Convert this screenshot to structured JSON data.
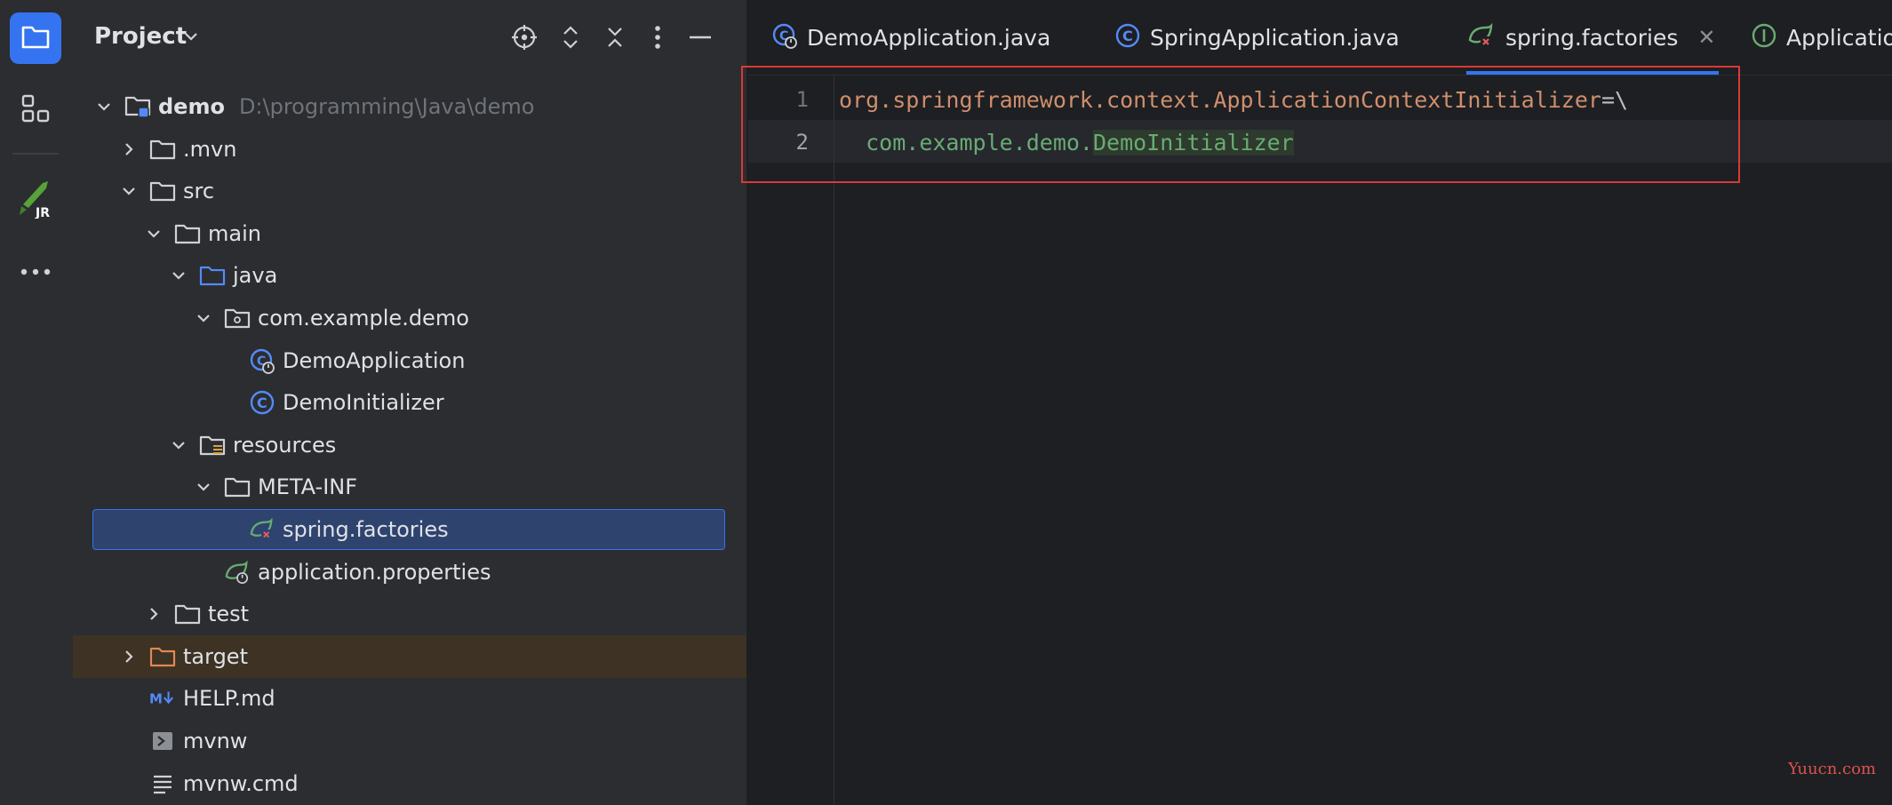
{
  "activity_bar": {
    "items": [
      {
        "name": "project-icon",
        "active": true
      },
      {
        "name": "structure-icon",
        "active": false
      },
      {
        "name": "jrebel-icon",
        "active": false,
        "label": "JR"
      },
      {
        "name": "more-icon",
        "active": false
      }
    ]
  },
  "project_panel": {
    "title": "Project",
    "header_icons": [
      "locate-icon",
      "expand-collapse-icon",
      "close-all-icon",
      "options-icon",
      "hide-icon"
    ],
    "tree": [
      {
        "label": "demo",
        "path": "D:\\programming\\Java\\demo",
        "indent": 0,
        "chevron": "down",
        "icon": "module-folder-icon",
        "bold": true
      },
      {
        "label": ".mvn",
        "indent": 1,
        "chevron": "right",
        "icon": "folder-icon"
      },
      {
        "label": "src",
        "indent": 1,
        "chevron": "down",
        "icon": "folder-icon"
      },
      {
        "label": "main",
        "indent": 2,
        "chevron": "down",
        "icon": "folder-icon"
      },
      {
        "label": "java",
        "indent": 3,
        "chevron": "down",
        "icon": "source-folder-icon"
      },
      {
        "label": "com.example.demo",
        "indent": 4,
        "chevron": "down",
        "icon": "package-icon"
      },
      {
        "label": "DemoApplication",
        "indent": 5,
        "chevron": "none",
        "icon": "spring-boot-class-icon"
      },
      {
        "label": "DemoInitializer",
        "indent": 5,
        "chevron": "none",
        "icon": "class-icon"
      },
      {
        "label": "resources",
        "indent": 3,
        "chevron": "down",
        "icon": "resources-folder-icon"
      },
      {
        "label": "META-INF",
        "indent": 4,
        "chevron": "down",
        "icon": "folder-icon"
      },
      {
        "label": "spring.factories",
        "indent": 5,
        "chevron": "none",
        "icon": "spring-factories-icon",
        "selected": true
      },
      {
        "label": "application.properties",
        "indent": 4,
        "chevron": "none",
        "icon": "spring-properties-icon"
      },
      {
        "label": "test",
        "indent": 2,
        "chevron": "right",
        "icon": "folder-icon"
      },
      {
        "label": "target",
        "indent": 1,
        "chevron": "right",
        "icon": "excluded-folder-icon",
        "excluded": true
      },
      {
        "label": "HELP.md",
        "indent": 1,
        "chevron": "none",
        "icon": "markdown-icon"
      },
      {
        "label": "mvnw",
        "indent": 1,
        "chevron": "none",
        "icon": "shell-script-icon"
      },
      {
        "label": "mvnw.cmd",
        "indent": 1,
        "chevron": "none",
        "icon": "text-file-icon"
      }
    ]
  },
  "editor": {
    "tabs": [
      {
        "label": "DemoApplication.java",
        "icon": "spring-boot-class-icon",
        "active": false
      },
      {
        "label": "SpringApplication.java",
        "icon": "class-icon",
        "active": false
      },
      {
        "label": "spring.factories",
        "icon": "spring-factories-icon",
        "active": true,
        "closable": true,
        "close_glyph": "✕"
      },
      {
        "label": "Applicatio",
        "icon": "interface-icon",
        "active": false
      }
    ],
    "line_numbers": [
      "1",
      "2"
    ],
    "code": {
      "line1": {
        "key": "org.springframework.context.ApplicationContextInitializer",
        "op": "=\\"
      },
      "line2": {
        "indent": "  ",
        "pkg": "com.example.demo.",
        "cls": "DemoInitializer"
      }
    }
  },
  "watermark": "Yuucn.com",
  "colors": {
    "accent": "#3574f0",
    "highlight_box": "#d93a35",
    "key": "#cf8e6d",
    "value": "#6aab73"
  }
}
